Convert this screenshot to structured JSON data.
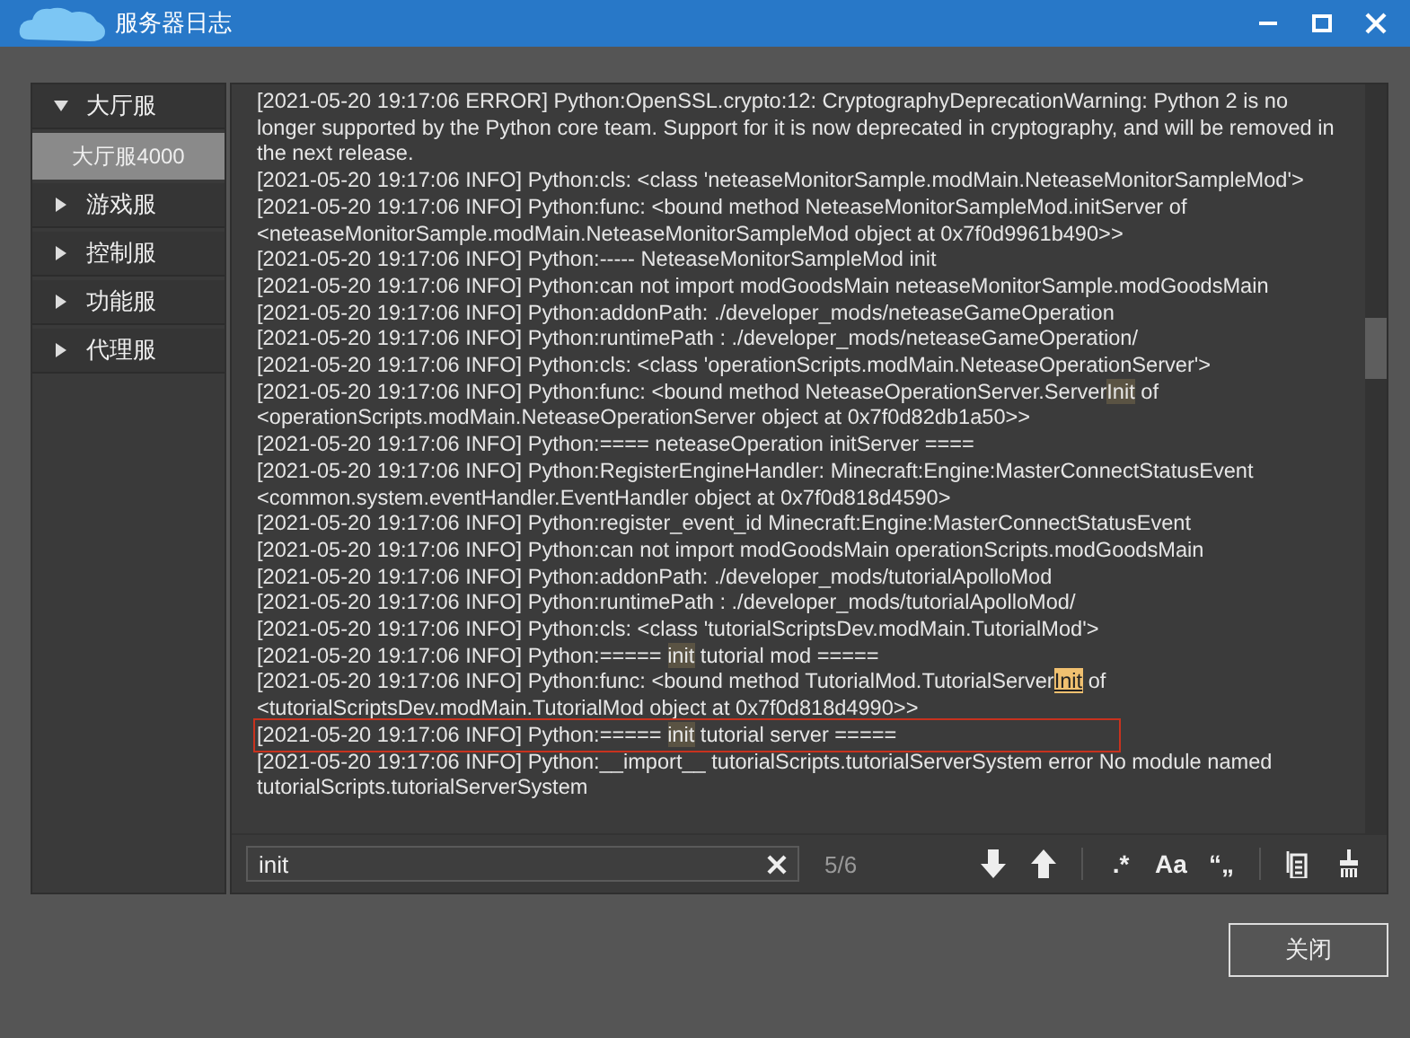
{
  "window": {
    "title": "服务器日志"
  },
  "sidebar": {
    "items": [
      {
        "label": "大厅服",
        "expanded": true,
        "selected": false,
        "children": [
          {
            "label": "大厅服4000",
            "selected": true
          }
        ]
      },
      {
        "label": "游戏服",
        "expanded": false,
        "selected": false
      },
      {
        "label": "控制服",
        "expanded": false,
        "selected": false
      },
      {
        "label": "功能服",
        "expanded": false,
        "selected": false
      },
      {
        "label": "代理服",
        "expanded": false,
        "selected": false
      }
    ]
  },
  "log": {
    "entries": [
      {
        "boxed": false,
        "segments": [
          {
            "text": "[2021-05-20 19:17:06 ERROR] Python:OpenSSL.crypto:12: CryptographyDeprecationWarning: Python 2 is no longer supported by the Python core team. Support for it is now deprecated in cryptography, and will be removed in the next release.",
            "match": false,
            "current": false
          }
        ]
      },
      {
        "boxed": false,
        "segments": [
          {
            "text": "[2021-05-20 19:17:06 INFO] Python:cls:  <class 'neteaseMonitorSample.modMain.NeteaseMonitorSampleMod'>",
            "match": false,
            "current": false
          }
        ]
      },
      {
        "boxed": false,
        "segments": [
          {
            "text": "[2021-05-20 19:17:06 INFO] Python:func:  <bound method NeteaseMonitorSampleMod.initServer of <neteaseMonitorSample.modMain.NeteaseMonitorSampleMod object at 0x7f0d9961b490>>",
            "match": false,
            "current": false
          }
        ]
      },
      {
        "boxed": false,
        "segments": [
          {
            "text": "[2021-05-20 19:17:06 INFO] Python:----- NeteaseMonitorSampleMod init",
            "match": false,
            "current": false
          }
        ]
      },
      {
        "boxed": false,
        "segments": [
          {
            "text": "[2021-05-20 19:17:06 INFO] Python:can not import modGoodsMain neteaseMonitorSample.modGoodsMain",
            "match": false,
            "current": false
          }
        ]
      },
      {
        "boxed": false,
        "segments": [
          {
            "text": "[2021-05-20 19:17:06 INFO] Python:addonPath:  ./developer_mods/neteaseGameOperation",
            "match": false,
            "current": false
          }
        ]
      },
      {
        "boxed": false,
        "segments": [
          {
            "text": "[2021-05-20 19:17:06 INFO] Python:runtimePath :  ./developer_mods/neteaseGameOperation/",
            "match": false,
            "current": false
          }
        ]
      },
      {
        "boxed": false,
        "segments": [
          {
            "text": "[2021-05-20 19:17:06 INFO] Python:cls:  <class 'operationScripts.modMain.NeteaseOperationServer'>",
            "match": false,
            "current": false
          }
        ]
      },
      {
        "boxed": false,
        "segments": [
          {
            "text": "[2021-05-20 19:17:06 INFO] Python:func:  <bound method NeteaseOperationServer.Server",
            "match": false,
            "current": false
          },
          {
            "text": "Init",
            "match": true,
            "current": false
          },
          {
            "text": " of <operationScripts.modMain.NeteaseOperationServer object at 0x7f0d82db1a50>>",
            "match": false,
            "current": false
          }
        ]
      },
      {
        "boxed": false,
        "segments": [
          {
            "text": "[2021-05-20 19:17:06 INFO] Python:==== neteaseOperation initServer ====",
            "match": false,
            "current": false
          }
        ]
      },
      {
        "boxed": false,
        "segments": [
          {
            "text": "[2021-05-20 19:17:06 INFO] Python:RegisterEngineHandler: Minecraft:Engine:MasterConnectStatusEvent <common.system.eventHandler.EventHandler object at 0x7f0d818d4590>",
            "match": false,
            "current": false
          }
        ]
      },
      {
        "boxed": false,
        "segments": [
          {
            "text": "[2021-05-20 19:17:06 INFO] Python:register_event_id Minecraft:Engine:MasterConnectStatusEvent",
            "match": false,
            "current": false
          }
        ]
      },
      {
        "boxed": false,
        "segments": [
          {
            "text": "[2021-05-20 19:17:06 INFO] Python:can not import modGoodsMain operationScripts.modGoodsMain",
            "match": false,
            "current": false
          }
        ]
      },
      {
        "boxed": false,
        "segments": [
          {
            "text": "[2021-05-20 19:17:06 INFO] Python:addonPath:  ./developer_mods/tutorialApolloMod",
            "match": false,
            "current": false
          }
        ]
      },
      {
        "boxed": false,
        "segments": [
          {
            "text": "[2021-05-20 19:17:06 INFO] Python:runtimePath :  ./developer_mods/tutorialApolloMod/",
            "match": false,
            "current": false
          }
        ]
      },
      {
        "boxed": false,
        "segments": [
          {
            "text": "[2021-05-20 19:17:06 INFO] Python:cls:  <class 'tutorialScriptsDev.modMain.TutorialMod'>",
            "match": false,
            "current": false
          }
        ]
      },
      {
        "boxed": false,
        "segments": [
          {
            "text": "[2021-05-20 19:17:06 INFO] Python:===== ",
            "match": false,
            "current": false
          },
          {
            "text": "init",
            "match": true,
            "current": false
          },
          {
            "text": " tutorial mod =====",
            "match": false,
            "current": false
          }
        ]
      },
      {
        "boxed": false,
        "segments": [
          {
            "text": "[2021-05-20 19:17:06 INFO] Python:func:  <bound method TutorialMod.TutorialServer",
            "match": false,
            "current": false
          },
          {
            "text": "Init",
            "match": true,
            "current": true
          },
          {
            "text": " of <tutorialScriptsDev.modMain.TutorialMod object at 0x7f0d818d4990>>",
            "match": false,
            "current": false
          }
        ]
      },
      {
        "boxed": true,
        "segments": [
          {
            "text": "[2021-05-20 19:17:06 INFO] Python:===== ",
            "match": false,
            "current": false
          },
          {
            "text": "init",
            "match": true,
            "current": false
          },
          {
            "text": " tutorial server =====",
            "match": false,
            "current": false
          }
        ]
      },
      {
        "boxed": false,
        "segments": [
          {
            "text": "[2021-05-20 19:17:06 INFO] Python:__import__ tutorialScripts.tutorialServerSystem error No module named tutorialScripts.tutorialServerSystem",
            "match": false,
            "current": false
          }
        ]
      }
    ]
  },
  "search": {
    "value": "init",
    "count": "5/6",
    "options": [
      ".*",
      "Aa",
      "“„"
    ]
  },
  "buttons": [
    "关闭"
  ]
}
